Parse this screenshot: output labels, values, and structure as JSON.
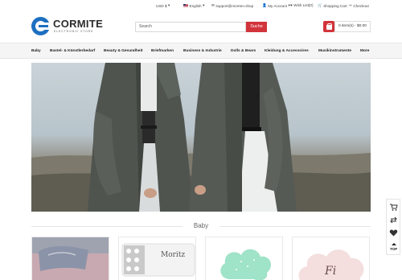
{
  "topbar": {
    "currency": "USD $",
    "language": "English",
    "email": "support@moreen.shop",
    "my_account": "My Account",
    "wish_list": "Wish List(0)",
    "shopping_cart": "Shopping Cart",
    "checkout": "Checkout"
  },
  "brand": {
    "name": "CORMITE",
    "tagline": "ELECTRONIC STORE",
    "color": "#1d6fc0"
  },
  "search": {
    "placeholder": "Search",
    "button_label": "Suche"
  },
  "cart": {
    "summary": "0 item(s) - $0.00"
  },
  "nav": {
    "items": [
      "Baby",
      "Bastel- & Künstlerbedarf",
      "Beauty & Gesundheit",
      "Briefmarken",
      "Business & Industrie",
      "Dolls & Bears",
      "Kleidung & Accessoires",
      "Musikinstrumente",
      "More"
    ]
  },
  "section": {
    "title": "Baby"
  },
  "cards": [
    {
      "name": "pillow-pink"
    },
    {
      "name": "pillow-moritz",
      "text": "Moritz"
    },
    {
      "name": "cloud-mint"
    },
    {
      "name": "cloud-pink",
      "text": "Fi"
    }
  ],
  "side_widget": {
    "top_label": "TOP"
  },
  "colors": {
    "accent": "#d2343b",
    "nav_bg": "#f5f5f5"
  }
}
